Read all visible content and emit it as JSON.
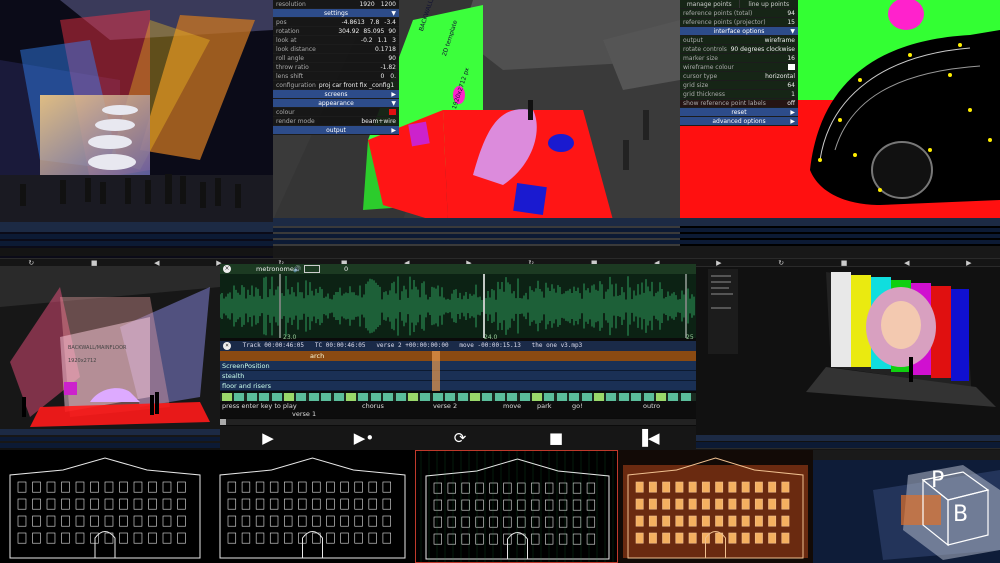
{
  "projector_panel": {
    "resolution_label": "resolution",
    "resolution_w": "1920",
    "resolution_h": "1200",
    "settings_header": "settings",
    "pos_label": "pos",
    "pos_x": "-4.8613",
    "pos_y": "7.8",
    "pos_z": "-3.4",
    "rotation_label": "rotation",
    "rot_x": "304.92",
    "rot_y": "85.095",
    "rot_z": "90",
    "lookat_label": "look at",
    "lookat_x": "-0.2",
    "lookat_y": "1.1",
    "lookat_z": "3",
    "lookdist_label": "look distance",
    "lookdist_value": "0.1718",
    "roll_label": "roll angle",
    "roll_value": "90",
    "throw_label": "throw ratio",
    "throw_value": "-1.82",
    "lensshift_label": "lens shift",
    "lensshift_a": "0",
    "lensshift_b": "0.",
    "config_label": "configuration",
    "config_value": "proj car front fix _config1",
    "screens_header": "screens",
    "appearance_header": "appearance",
    "colour_label": "colour",
    "colour_hex": "#e01010",
    "render_label": "render mode",
    "render_value": "beam+wire",
    "output_header": "output"
  },
  "calibration_panel": {
    "manage_points": "manage points",
    "line_up_points": "line up points",
    "ref_total_label": "reference points (total)",
    "ref_total_value": "94",
    "ref_proj_label": "reference points (projector)",
    "ref_proj_value": "15",
    "interface_header": "interface options",
    "output_label": "output",
    "output_value": "wireframe",
    "rotate_label": "rotate controls",
    "rotate_value": "90 degrees clockwise",
    "marker_label": "marker size",
    "marker_value": "16",
    "wfcolour_label": "wireframe colour",
    "cursor_label": "cursor type",
    "cursor_value": "horizontal",
    "grid_label": "grid size",
    "grid_value": "64",
    "gridthick_label": "grid thickness",
    "gridthick_value": "1",
    "showlabels_label": "show reference point labels",
    "showlabels_value": "off",
    "reset_header": "reset",
    "advanced_header": "advanced options"
  },
  "wall_text": {
    "line1": "BACKWALL/MAINFLOOR",
    "line2": "2D template",
    "line3": "1920x2712 px"
  },
  "small_wall_text": {
    "line1": "BACKWALL/MAINFLOOR",
    "line2": "1920x2712"
  },
  "timeline": {
    "metronome_label": "metronome",
    "bar_number": "0",
    "ruler": [
      "23.0",
      "24.0",
      "25"
    ],
    "status": {
      "track": "Track 00:00:46:05",
      "tc": "TC 00:00:46:05",
      "section": "verse 2 +00:00:00:00",
      "move": "move -00:00:15.13",
      "file": "the one v3.mp3"
    },
    "arch_label": "arch",
    "lanes": [
      "ScreenPosition",
      "stealth",
      "floor and risers"
    ],
    "markers": [
      "press enter key to play",
      "chorus",
      "verse 2",
      "move",
      "park",
      "go!",
      "outro"
    ],
    "verse1_label": "verse 1",
    "transport": [
      "play-icon",
      "play-to-marker-icon",
      "loop-icon",
      "stop-icon",
      "rewind-icon"
    ]
  },
  "pb_labels": {
    "letter_p": "P",
    "letter_b": "B"
  },
  "colors": {
    "accent_blue": "#2d4c8a",
    "timeline_green": "#2e9e5c",
    "cue_green": "#5bbd9b",
    "projector_red": "#ff1a1a",
    "projector_green": "#2aff2a"
  }
}
